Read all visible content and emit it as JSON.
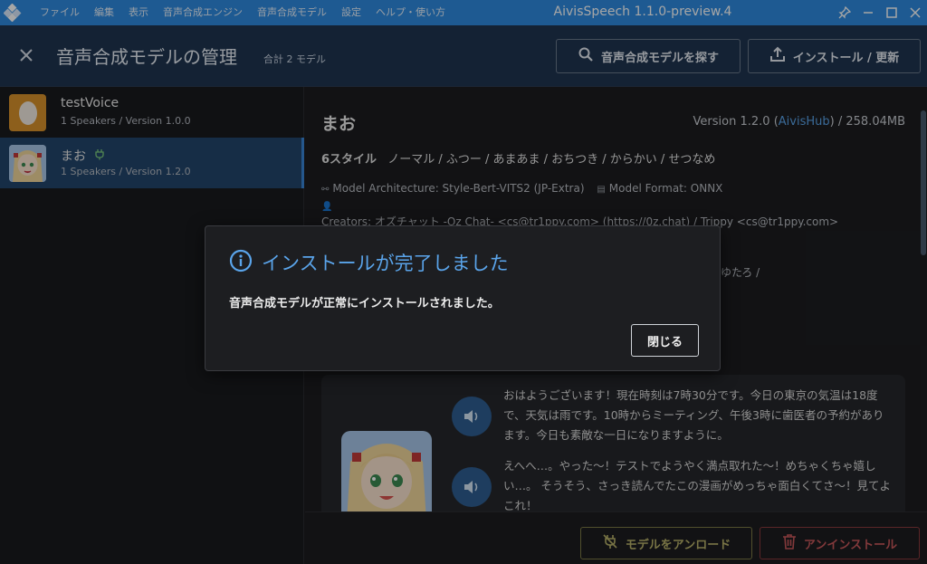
{
  "titlebar": {
    "menu": [
      "ファイル",
      "編集",
      "表示",
      "音声合成エンジン",
      "音声合成モデル",
      "設定",
      "ヘルプ・使い方"
    ],
    "title": "AivisSpeech 1.1.0-preview.4",
    "icons": [
      "app-logo-icon",
      "pin-icon",
      "minimize-icon",
      "maximize-icon",
      "close-window-icon"
    ]
  },
  "header": {
    "title": "音声合成モデルの管理",
    "total": "合計 2 モデル",
    "find_button": "音声合成モデルを探す",
    "install_button": "インストール / 更新"
  },
  "sidebar": {
    "models": [
      {
        "name": "testVoice",
        "meta": "1 Speakers / Version 1.0.0",
        "active": false
      },
      {
        "name": "まお",
        "meta": "1 Speakers / Version 1.2.0",
        "active": true
      }
    ]
  },
  "detail": {
    "name": "まお",
    "version": "Version 1.2.0",
    "source": "AivisHub",
    "size": "/ 258.04MB",
    "styles_count": "6スタイル",
    "styles": "ノーマル / ふつー / あまあま / おちつき / からかい / せつなめ",
    "architecture": "Model Architecture: Style-Bert-VITS2 (JP-Extra)",
    "format": "Model Format: ONNX",
    "creators": "Creators: オズチャット -Oz Chat- <cs@tr1ppy.com> (https://0z.chat) / Trippy <cs@tr1ppy.com>",
    "creators_tail": "ゆたろ /",
    "samples": [
      "おはようございます！現在時刻は7時30分です。今日の東京の気温は18度で、天気は雨です。10時からミーティング、午後3時に歯医者の予約があります。今日も素敵な一日になりますように。",
      "えへへ…。やった～！テストでようやく満点取れた～！めちゃくちゃ嬉しい…。 そうそう、さっき読んでたこの漫画がめっちゃ面白くてさ～！見てよこれ！"
    ]
  },
  "bottom": {
    "unload_button": "モデルをアンロード",
    "uninstall_button": "アンインストール"
  },
  "dialog": {
    "title": "インストールが完了しました",
    "message": "音声合成モデルが正常にインストールされました。",
    "close_button": "閉じる"
  },
  "colors": {
    "titlebar": "#2f8be0",
    "header": "#1f3550",
    "accent": "#5aa4ea",
    "active_item": "#23466c",
    "unload": "#b9b26a",
    "uninstall": "#c9585b"
  }
}
